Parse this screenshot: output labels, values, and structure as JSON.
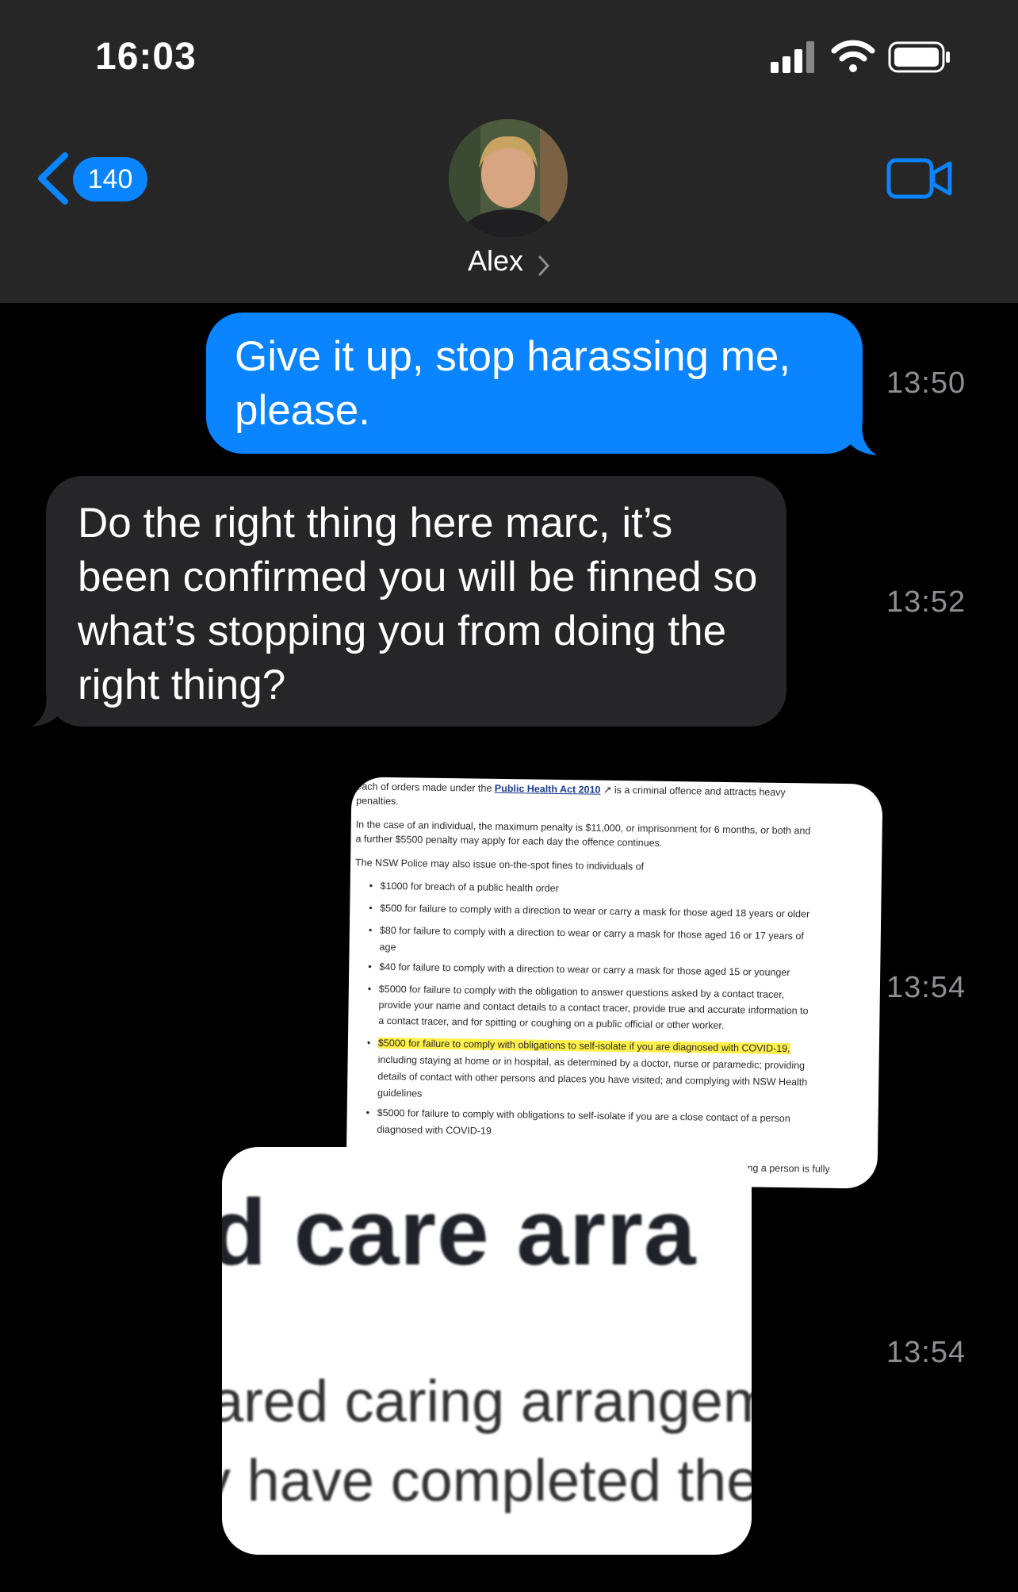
{
  "status_bar": {
    "time": "16:03"
  },
  "nav": {
    "back_count": "140",
    "contact_name": "Alex",
    "icons": [
      "chevron-left-icon",
      "video-camera-icon",
      "chevron-right-icon"
    ],
    "accent_color": "#0a84ff"
  },
  "messages": [
    {
      "direction": "outgoing",
      "text": "Give it up, stop harassing me, please.",
      "time": "13:50"
    },
    {
      "direction": "incoming",
      "text": "Do the right thing here marc, it’s been confirmed you will be finned so what’s stopping you from doing the right thing?",
      "time": "13:52"
    },
    {
      "direction": "incoming",
      "type": "image",
      "time": "13:54",
      "image_text": {
        "line1_pre": "each of orders made under the",
        "line1_link": "Public Health Act 2010",
        "line1_post": "is a criminal offence and attracts heavy",
        "line2": "penalties.",
        "para2_l1": "In the case of an individual, the maximum penalty is $11,000, or imprisonment for 6 months, or both and",
        "para2_l2": "a further $5500 penalty may apply for each day the offence continues.",
        "para3": "The NSW Police may also issue on-the-spot fines to individuals of",
        "b1": "$1000 for breach of a public health order",
        "b2": "$500 for failure to comply with a direction to wear or carry a mask for those aged 18 years or older",
        "b3_l1": "$80 for failure to comply with a direction to wear or carry a mask for those aged 16 or 17 years of",
        "b3_l2": "age",
        "b4": "$40 for failure to comply with a direction to wear or carry a mask for those aged 15 or younger",
        "b5_l1": "$5000 for failure to comply with the obligation to answer questions asked by a contact tracer,",
        "b5_l2": "provide your name and contact details to a contact tracer, provide true and accurate information to",
        "b5_l3": "a contact tracer, and for spitting or coughing on a public official or other worker.",
        "b6_hl": "$5000 for failure to comply with obligations to self-isolate if you are diagnosed with COVID-19,",
        "b6_l2": "including staying at home or in hospital, as determined by a doctor, nurse or paramedic;  providing",
        "b6_l3": "details of contact with other persons and places you have visited; and complying with NSW Health",
        "b6_l4": "guidelines",
        "b7_l1": "$5000 for failure to comply with obligations to self-isolate if you are a close contact of a person",
        "b7_l2": "diagnosed with COVID-19",
        "tail": "howing a person is fully"
      }
    },
    {
      "direction": "incoming",
      "type": "image",
      "time": "13:54",
      "image_text": {
        "big": "d care arra",
        "mid1": "ared caring arrangem",
        "mid2": "y have completed the"
      }
    }
  ]
}
